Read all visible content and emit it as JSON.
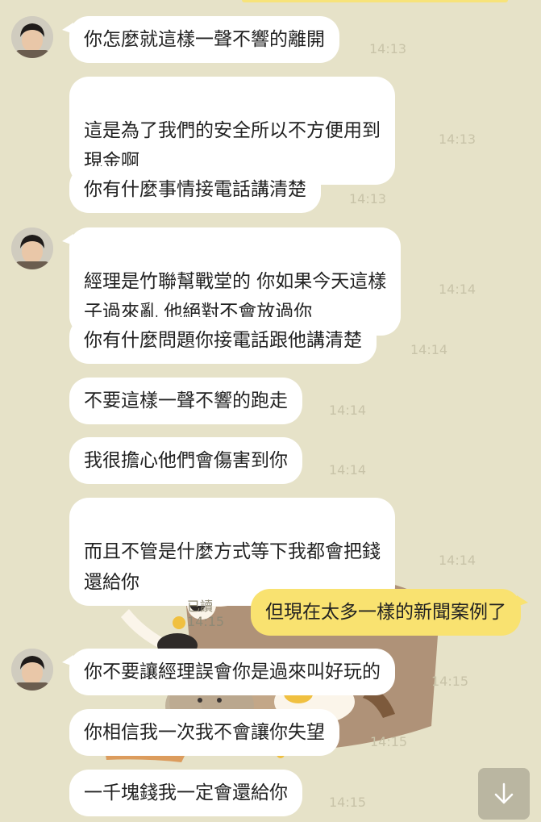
{
  "messages": [
    {
      "text": "你怎麼就這樣一聲不響的離開",
      "time": "14:13"
    },
    {
      "text": "這是為了我們的安全所以不方便用到\n現金啊",
      "time": "14:13"
    },
    {
      "text": "你有什麼事情接電話講清楚",
      "time": "14:13"
    },
    {
      "text": "經理是竹聯幫戰堂的 你如果今天這樣\n子過來亂 他絕對不會放過你",
      "time": "14:14"
    },
    {
      "text": "你有什麼問題你接電話跟他講清楚",
      "time": "14:14"
    },
    {
      "text": "不要這樣一聲不響的跑走",
      "time": "14:14"
    },
    {
      "text": "我很擔心他們會傷害到你",
      "time": "14:14"
    },
    {
      "text": "而且不管是什麼方式等下我都會把錢\n還給你",
      "time": "14:14"
    },
    {
      "text": "但現在太多一樣的新聞案例了",
      "time": "14:15",
      "status": "已讀"
    },
    {
      "text": "你不要讓經理誤會你是過來叫好玩的",
      "time": "14:15"
    },
    {
      "text": "你相信我一次我不會讓你失望",
      "time": "14:15"
    },
    {
      "text": "一千塊錢我一定會還給你",
      "time": "14:15"
    }
  ],
  "icons": {
    "avatar": "contact-avatar-icon",
    "scroll": "arrow-down-icon"
  },
  "colors": {
    "background": "#e6e2c8",
    "incoming_bubble": "#ffffff",
    "outgoing_bubble": "#f9e270",
    "timestamp": "#c8c3a8"
  }
}
